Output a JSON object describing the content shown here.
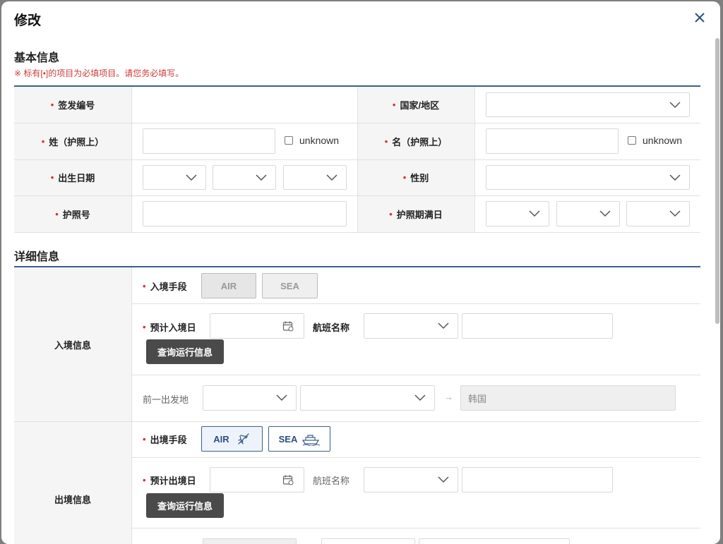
{
  "modal": {
    "title": "修改"
  },
  "basic": {
    "title": "基本信息",
    "notice": "※ 标有[•]的项目为必填项目。请您务必填写。",
    "required_mark": "•",
    "issue_no_label": "签发编号",
    "country_label": "国家/地区",
    "surname_label": "姓（护照上）",
    "given_label": "名（护照上）",
    "unknown_label": "unknown",
    "birth_label": "出生日期",
    "gender_label": "性别",
    "passport_label": "护照号",
    "expiry_label": "护照期满日"
  },
  "detail": {
    "title": "详细信息",
    "entry": {
      "label": "入境信息",
      "mode_label": "入境手段",
      "air": "AIR",
      "sea": "SEA",
      "date_label": "预计入境日",
      "flight_label": "航班名称",
      "query_button": "查询运行信息",
      "prev_label": "前一出发地",
      "arrow": "→",
      "destination": "韩国"
    },
    "exit": {
      "label": "出境信息",
      "mode_label": "出境手段",
      "air": "AIR",
      "sea": "SEA",
      "date_label": "预计出境日",
      "flight_label": "航班名称",
      "query_button": "查询运行信息"
    }
  },
  "icons": {
    "close": "close-icon",
    "chevron": "chevron-down-icon",
    "calendar": "calendar-icon",
    "plane": "airplane-icon",
    "ship": "ship-icon"
  },
  "colors": {
    "accent": "#3c5f8c",
    "required": "#d03a3a",
    "dark_button": "#4a4a4a"
  }
}
